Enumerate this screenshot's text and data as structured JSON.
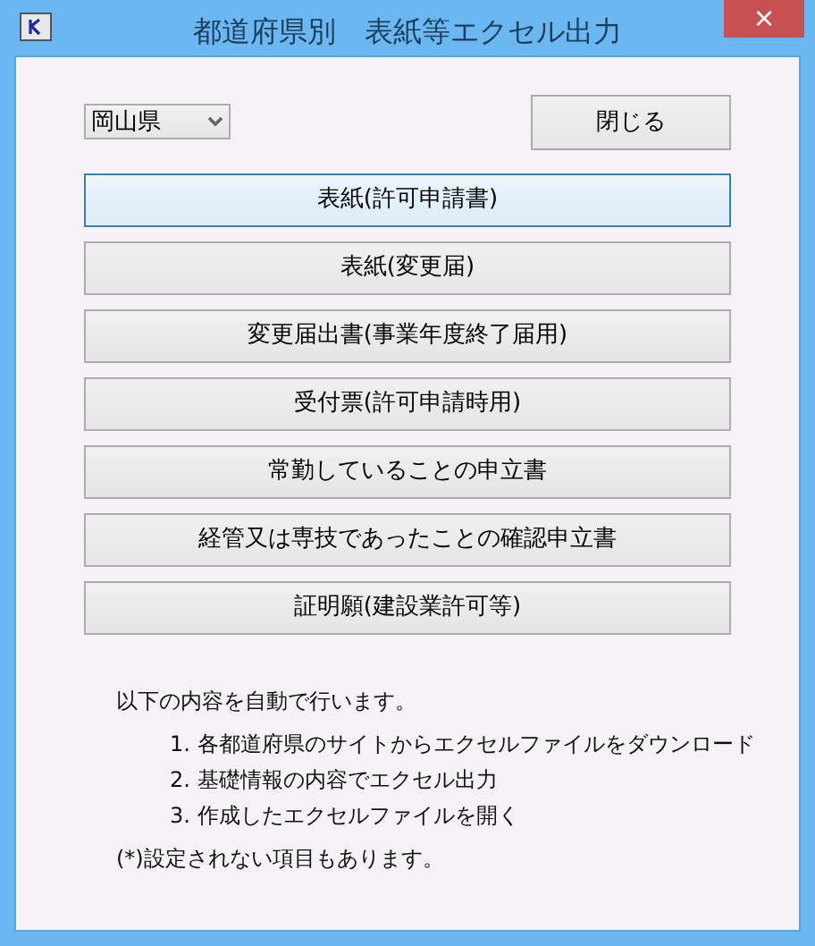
{
  "window": {
    "title": "都道府県別　表紙等エクセル出力",
    "close": "×"
  },
  "prefecture": {
    "value": "岡山県"
  },
  "close_button": "閉じる",
  "buttons": [
    {
      "label": "表紙(許可申請書)",
      "focused": true
    },
    {
      "label": "表紙(変更届)",
      "focused": false
    },
    {
      "label": "変更届出書(事業年度終了届用)",
      "focused": false
    },
    {
      "label": "受付票(許可申請時用)",
      "focused": false
    },
    {
      "label": "常勤していることの申立書",
      "focused": false
    },
    {
      "label": "経管又は専技であったことの確認申立書",
      "focused": false
    },
    {
      "label": "証明願(建設業許可等)",
      "focused": false
    }
  ],
  "info": {
    "intro": "以下の内容を自動で行います。",
    "steps": [
      "1. 各都道府県のサイトからエクセルファイルをダウンロード",
      "2. 基礎情報の内容でエクセル出力",
      "3. 作成したエクセルファイルを開く"
    ],
    "note": "(*)設定されない項目もあります。"
  }
}
